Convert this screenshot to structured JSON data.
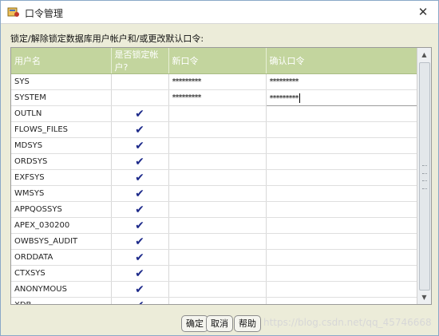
{
  "window": {
    "title": "口令管理",
    "close_glyph": "✕"
  },
  "instruction": "锁定/解除锁定数据库用户帐户和/或更改默认口令:",
  "table": {
    "columns": [
      "用户名",
      "是否锁定帐户?",
      "新口令",
      "确认口令"
    ],
    "rows": [
      {
        "user": "SYS",
        "locked": false,
        "new_password": "*********",
        "confirm_password": "*********"
      },
      {
        "user": "SYSTEM",
        "locked": false,
        "new_password": "*********",
        "confirm_password": "*********"
      },
      {
        "user": "OUTLN",
        "locked": true,
        "new_password": "",
        "confirm_password": ""
      },
      {
        "user": "FLOWS_FILES",
        "locked": true,
        "new_password": "",
        "confirm_password": ""
      },
      {
        "user": "MDSYS",
        "locked": true,
        "new_password": "",
        "confirm_password": ""
      },
      {
        "user": "ORDSYS",
        "locked": true,
        "new_password": "",
        "confirm_password": ""
      },
      {
        "user": "EXFSYS",
        "locked": true,
        "new_password": "",
        "confirm_password": ""
      },
      {
        "user": "WMSYS",
        "locked": true,
        "new_password": "",
        "confirm_password": ""
      },
      {
        "user": "APPQOSSYS",
        "locked": true,
        "new_password": "",
        "confirm_password": ""
      },
      {
        "user": "APEX_030200",
        "locked": true,
        "new_password": "",
        "confirm_password": ""
      },
      {
        "user": "OWBSYS_AUDIT",
        "locked": true,
        "new_password": "",
        "confirm_password": ""
      },
      {
        "user": "ORDDATA",
        "locked": true,
        "new_password": "",
        "confirm_password": ""
      },
      {
        "user": "CTXSYS",
        "locked": true,
        "new_password": "",
        "confirm_password": ""
      },
      {
        "user": "ANONYMOUS",
        "locked": true,
        "new_password": "",
        "confirm_password": ""
      },
      {
        "user": "XDB",
        "locked": true,
        "new_password": "",
        "confirm_password": ""
      }
    ],
    "check_glyph": "✔"
  },
  "buttons": {
    "ok": "确定",
    "cancel": "取消",
    "help": "帮助"
  },
  "watermark": "https://blog.csdn.net/qq_45746668",
  "colors": {
    "header_bg": "#c3d59e",
    "check": "#1d2a8a",
    "window_bg": "#ececd9"
  }
}
